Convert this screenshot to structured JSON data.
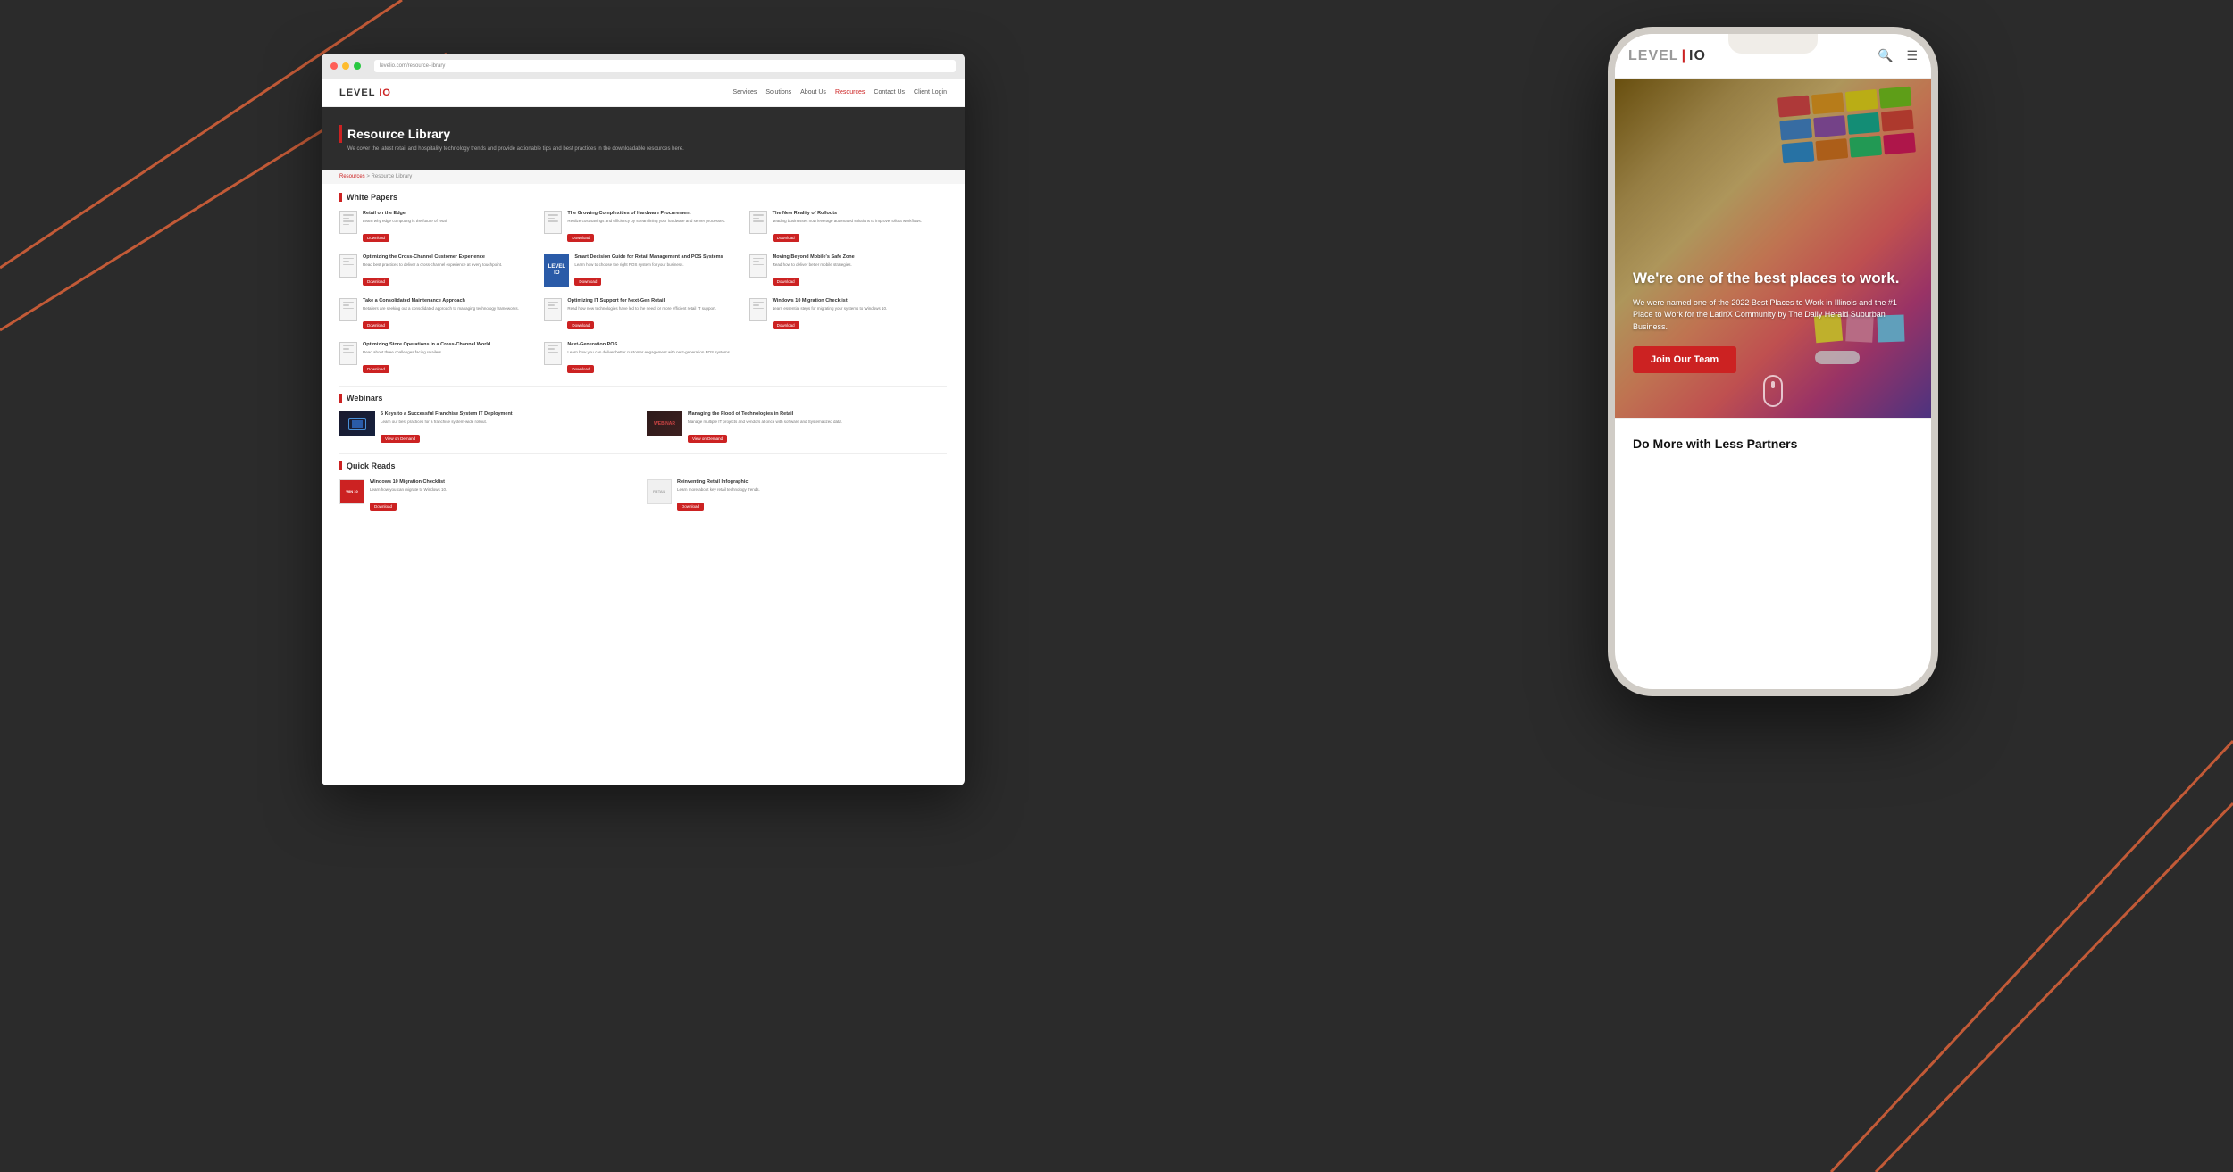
{
  "page": {
    "background_color": "#2a2a2a"
  },
  "desktop_mockup": {
    "nav": {
      "logo": "LEVEL IO",
      "logo_accent": "IO",
      "nav_items": [
        "Services",
        "Solutions",
        "About Us",
        "Resources",
        "Contact Us",
        "Client Login"
      ]
    },
    "hero": {
      "title": "Resource Library",
      "subtitle": "We cover the latest retail and hospitality technology trends and provide actionable tips and best practices in the downloadable resources here."
    },
    "breadcrumb": "Resources > Resource Library",
    "white_papers": {
      "section_title": "White Papers",
      "items": [
        {
          "title": "Retail on the Edge",
          "desc": "Learn why edge computing is the future of retail",
          "btn": "Download"
        },
        {
          "title": "The Growing Complexities of Hardware Procurement",
          "desc": "Realize cost savings and efficiency by streamlining your hardware and server processes.",
          "btn": "Download"
        },
        {
          "title": "The New Reality of Rollouts",
          "desc": "Leading businesses now leverage automated solutions to improve rollout workflows.",
          "btn": "Download"
        },
        {
          "title": "Optimizing the Cross-Channel Customer Experience",
          "desc": "Read best practices to deliver a cross-channel experience at every touchpoint.",
          "btn": "Download"
        },
        {
          "title": "Smart Decision Guide for Retail Management and POS Systems",
          "desc": "Learn how to choose the right POS system for your business.",
          "btn": "Download"
        },
        {
          "title": "Moving Beyond Mobile's Safe Zone",
          "desc": "Read how to deliver better mobile strategies.",
          "btn": "Download"
        },
        {
          "title": "Take a Consolidated Maintenance Approach",
          "desc": "Retailers are seeking out a consolidated approach to managing technology frameworks.",
          "btn": "Download"
        },
        {
          "title": "Optimizing IT Support for Next-Gen Retail",
          "desc": "Read how new technologies have led to the need for more efficient retail IT support.",
          "btn": "Download"
        },
        {
          "title": "Windows 10 Migration Checklist",
          "desc": "Learn essential steps for migrating your systems to Windows 10.",
          "btn": "Download"
        },
        {
          "title": "Optimizing Store Operations in a Cross-Channel World",
          "desc": "Read about three challenges facing retailers.",
          "btn": "Download"
        },
        {
          "title": "Next-Generation POS",
          "desc": "Learn how you can deliver better customer engagement with next-generation POS systems.",
          "btn": "Download"
        }
      ]
    },
    "webinars": {
      "section_title": "Webinars",
      "items": [
        {
          "title": "5 Keys to a Successful Franchise System IT Deployment",
          "desc": "Learn our best practices for a franchise system-wide rollout.",
          "btn": "View on Demand"
        },
        {
          "title": "Managing the Flood of Technologies in Retail",
          "desc": "Manage multiple IT projects and vendors at once with software and Systematized data.",
          "btn": "View on Demand"
        }
      ]
    },
    "quick_reads": {
      "section_title": "Quick Reads",
      "items": [
        {
          "title": "Windows 10 Migration Checklist",
          "desc": "Learn how you can migrate to Windows 10.",
          "btn": "Download"
        },
        {
          "title": "Reinventing Retail Infographic",
          "desc": "Learn more about key retail technology trends.",
          "btn": "Download"
        }
      ]
    }
  },
  "phone_mockup": {
    "nav": {
      "logo_level": "LEVEL",
      "logo_pipe": "|",
      "logo_io": "IO"
    },
    "hero": {
      "heading": "We're one of the best places to work.",
      "body": "We were named one of the 2022 Best Places to Work in Illinois and the #1 Place to Work for the LatinX Community by The Daily Herald Suburban Business.",
      "cta_button": "Join Our Team"
    },
    "bottom": {
      "title": "Do More with Less Partners"
    }
  },
  "swatches": [
    {
      "color": "#e8474a",
      "label": "red swatch"
    },
    {
      "color": "#f5a623",
      "label": "orange swatch"
    },
    {
      "color": "#f8e71c",
      "label": "yellow swatch"
    },
    {
      "color": "#7ed321",
      "label": "green swatch"
    },
    {
      "color": "#4a90d9",
      "label": "blue swatch"
    },
    {
      "color": "#9b59b6",
      "label": "purple swatch"
    },
    {
      "color": "#1abc9c",
      "label": "teal swatch"
    },
    {
      "color": "#e74c3c",
      "label": "crimson swatch"
    },
    {
      "color": "#3498db",
      "label": "sky swatch"
    },
    {
      "color": "#e67e22",
      "label": "dark-orange swatch"
    },
    {
      "color": "#2ecc71",
      "label": "emerald swatch"
    },
    {
      "color": "#e91e63",
      "label": "pink swatch"
    }
  ]
}
